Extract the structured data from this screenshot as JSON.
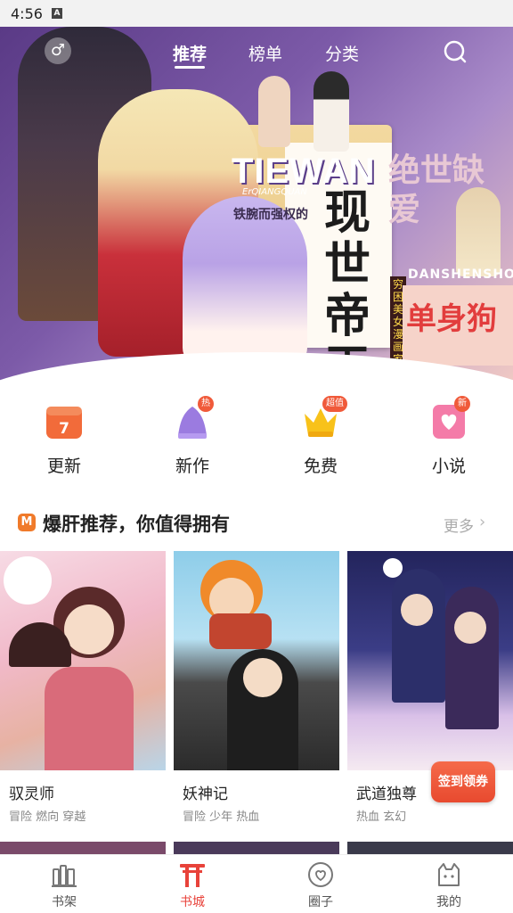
{
  "status_bar": {
    "time": "4:56",
    "notification_icon": "A"
  },
  "top_nav": {
    "gender_icon": "♂",
    "tabs": [
      {
        "label": "推荐",
        "active": true
      },
      {
        "label": "榜单",
        "active": false
      },
      {
        "label": "分类",
        "active": false
      }
    ],
    "search_icon": "search-icon"
  },
  "hero": {
    "brand": "TIEWAN",
    "brand_sub": "ErQIANGQUAN",
    "tagline": "铁腕而强权的",
    "title": "现世帝王",
    "side_label": "穷困美女漫画家",
    "right_title_top": "绝世缺爱",
    "right_en": "DANSHENSHOU",
    "right_title": "单身狗"
  },
  "quick_links": [
    {
      "label": "更新",
      "icon": "calendar-icon",
      "badge": "",
      "badge_text_day": "7"
    },
    {
      "label": "新作",
      "icon": "bell-icon",
      "badge": "热"
    },
    {
      "label": "免费",
      "icon": "crown-icon",
      "badge": "超值"
    },
    {
      "label": "小说",
      "icon": "heart-book-icon",
      "badge": "新"
    }
  ],
  "section": {
    "logo": "M",
    "title": "爆肝推荐，你值得拥有",
    "more": "更多",
    "more_arrow": "›"
  },
  "comics": [
    {
      "title": "驭灵师",
      "tags": "冒险 燃向 穿越"
    },
    {
      "title": "妖神记",
      "tags": "冒险 少年 热血"
    },
    {
      "title": "武道独尊",
      "tags": "热血 玄幻"
    }
  ],
  "sign_button": "签到领券",
  "bottom_nav": [
    {
      "label": "书架",
      "icon": "bookshelf-icon",
      "active": false
    },
    {
      "label": "书城",
      "icon": "bookstore-gate-icon",
      "active": true
    },
    {
      "label": "圈子",
      "icon": "circle-heart-icon",
      "active": false
    },
    {
      "label": "我的",
      "icon": "cat-face-icon",
      "active": false
    }
  ],
  "colors": {
    "accent": "#e8423a",
    "quick_orange": "#f26b3a",
    "badge": "#f05a3a"
  }
}
